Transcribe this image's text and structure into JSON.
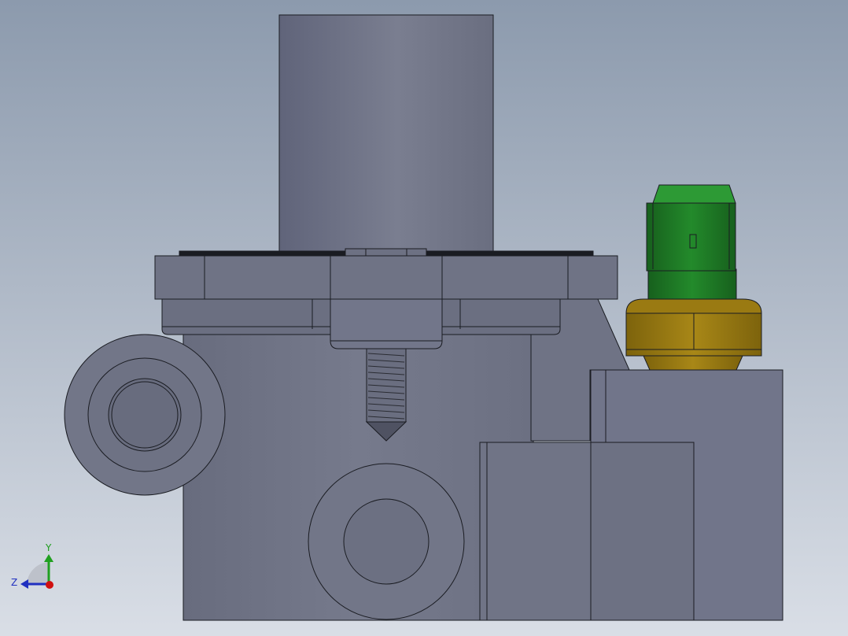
{
  "viewport": {
    "background_top": "#8c9aad",
    "background_bottom": "#d9dee6"
  },
  "model": {
    "body_color": "#747888",
    "body_dark": "#5f6373",
    "edge_color": "#1a1c22",
    "sensor_cap_color": "#1f7a26",
    "sensor_hex_color": "#9a7a12"
  },
  "triad": {
    "y_label": "Y",
    "z_label": "Z",
    "x_color": "#d01010",
    "y_color": "#20a020",
    "z_color": "#2030c0"
  },
  "icons": {
    "triad": "coordinate-triad-icon"
  }
}
